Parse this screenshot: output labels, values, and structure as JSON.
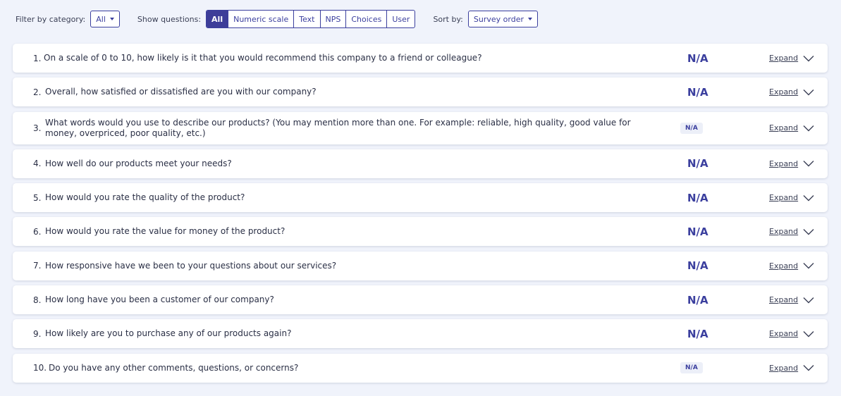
{
  "toolbar": {
    "filter_label": "Filter by category:",
    "filter_value": "All",
    "show_label": "Show questions:",
    "show_options": [
      "All",
      "Numeric scale",
      "Text",
      "NPS",
      "Choices",
      "User"
    ],
    "show_active": "All",
    "sort_label": "Sort by:",
    "sort_value": "Survey order"
  },
  "expand_label": "Expand",
  "questions": [
    {
      "num": "1.",
      "text": "On a scale of 0 to 10, how likely is it that you would recommend this company to a friend or colleague?",
      "score": "N/A"
    },
    {
      "num": "2.",
      "text": "Overall, how satisfied or dissatisfied are you with our company?",
      "score": "N/A"
    },
    {
      "num": "3.",
      "text": "What words would you use to describe our products? (You may mention more than one. For example: reliable, high quality, good value for money, overpriced, poor quality, etc.)",
      "score": "N/A"
    },
    {
      "num": "4.",
      "text": "How well do our products meet your needs?",
      "score": "N/A"
    },
    {
      "num": "5.",
      "text": "How would you rate the quality of the product?",
      "score": "N/A"
    },
    {
      "num": "6.",
      "text": "How would you rate the value for money of the product?",
      "score": "N/A"
    },
    {
      "num": "7.",
      "text": "How responsive have we been to your questions about our services?",
      "score": "N/A"
    },
    {
      "num": "8.",
      "text": "How long have you been a customer of our company?",
      "score": "N/A"
    },
    {
      "num": "9.",
      "text": "How likely are you to purchase any of our products again?",
      "score": "N/A"
    },
    {
      "num": "10.",
      "text": "Do you have any other comments, questions, or concerns?",
      "score": "N/A"
    }
  ],
  "colors": {
    "accent": "#3b3f9e",
    "active_button": "#3d3d99",
    "background": "#f0f3fb",
    "badge_bg": "#eceff8"
  }
}
